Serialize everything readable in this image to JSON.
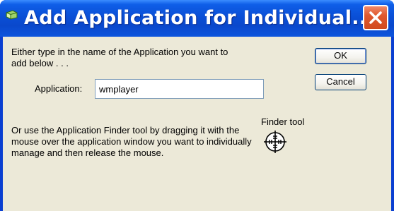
{
  "window": {
    "title": "Add Application for Individual..."
  },
  "dialog": {
    "instruction": "Either type in the name of the Application you want to add below . . .",
    "application_label": "Application:",
    "application_value": "wmplayer",
    "finder_instruction": "Or use the Application Finder tool by dragging it with the mouse over the application window you want to individually manage and then release the mouse.",
    "finder_tool_label": "Finder tool"
  },
  "buttons": {
    "ok_label": "OK",
    "cancel_label": "Cancel"
  },
  "icons": {
    "app_icon": "app-icon",
    "close": "close-icon",
    "finder": "crosshair-icon"
  },
  "colors": {
    "titlebar": "#0a48cc",
    "close_button": "#e0582e",
    "dialog_background": "#ece9d8"
  }
}
